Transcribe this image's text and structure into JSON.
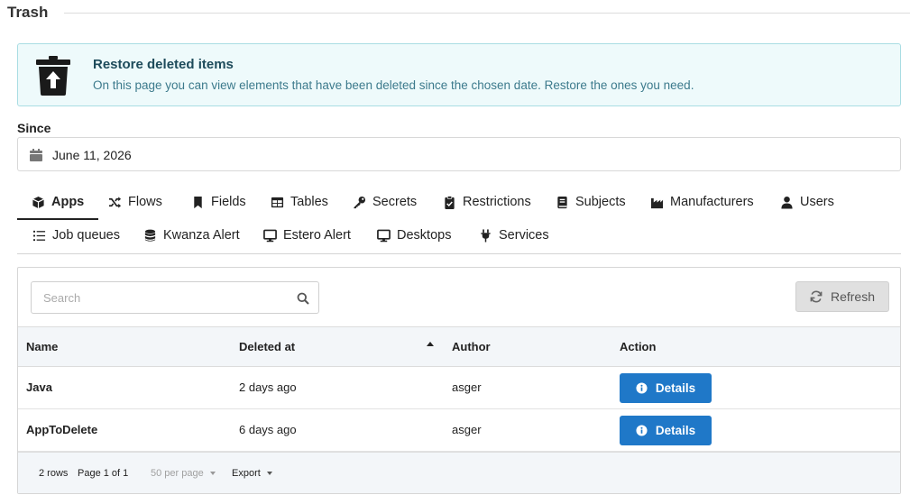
{
  "page": {
    "title": "Trash"
  },
  "notice": {
    "title": "Restore deleted items",
    "text": "On this page you can view elements that have been deleted since the chosen date. Restore the ones you need."
  },
  "since": {
    "label": "Since",
    "value": "June 11, 2026"
  },
  "tabs": [
    {
      "label": "Apps",
      "icon": "cube-icon",
      "active": true
    },
    {
      "label": "Flows",
      "icon": "shuffle-icon"
    },
    {
      "label": "Fields",
      "icon": "bookmark-icon"
    },
    {
      "label": "Tables",
      "icon": "table-icon"
    },
    {
      "label": "Secrets",
      "icon": "key-icon"
    },
    {
      "label": "Restrictions",
      "icon": "clipboard-check-icon"
    },
    {
      "label": "Subjects",
      "icon": "book-icon"
    },
    {
      "label": "Manufacturers",
      "icon": "factory-icon"
    },
    {
      "label": "Users",
      "icon": "user-icon"
    },
    {
      "label": "Job queues",
      "icon": "list-icon"
    },
    {
      "label": "Kwanza Alert",
      "icon": "database-icon"
    },
    {
      "label": "Estero Alert",
      "icon": "desktop-icon"
    },
    {
      "label": "Desktops",
      "icon": "desktop-icon"
    },
    {
      "label": "Services",
      "icon": "plug-icon"
    }
  ],
  "toolbar": {
    "search_placeholder": "Search",
    "refresh_label": "Refresh"
  },
  "table": {
    "columns": [
      "Name",
      "Deleted at",
      "Author",
      "Action"
    ],
    "rows": [
      {
        "name": "Java",
        "deleted_at": "2 days ago",
        "author": "asger",
        "action": "Details"
      },
      {
        "name": "AppToDelete",
        "deleted_at": "6 days ago",
        "author": "asger",
        "action": "Details"
      }
    ]
  },
  "footer": {
    "rows": "2 rows",
    "page": "Page 1 of 1",
    "per_page": "50 per page",
    "export": "Export"
  },
  "colors": {
    "accent": "#1f78c8",
    "notice_bg": "#eefafb",
    "notice_border": "#a9dde3",
    "header_bg": "#f3f6f9"
  }
}
